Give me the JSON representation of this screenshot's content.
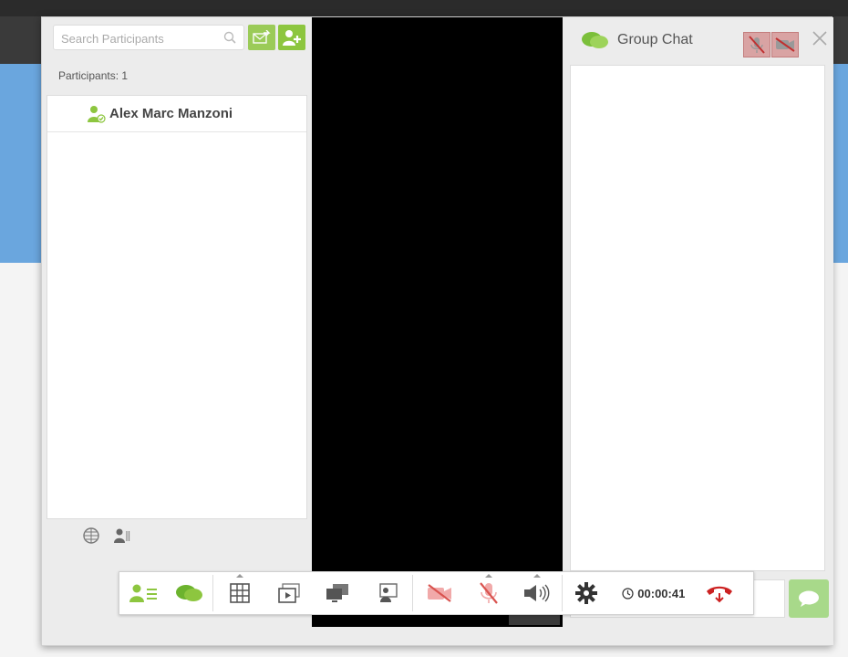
{
  "colors": {
    "accent_green": "#8dc63f",
    "mute_red": "#d9534f",
    "hangup_red": "#cc2222"
  },
  "participants_panel": {
    "search_placeholder": "Search Participants",
    "count_label": "Participants: 1",
    "participants": [
      {
        "name": "Alex Marc Manzoni",
        "icon": "user-check-icon"
      }
    ],
    "footer_icons": [
      "grid-globe-icon",
      "user-list-icon"
    ]
  },
  "chat": {
    "title": "Group Chat",
    "title_icon": "chat-bubbles-icon",
    "input_placeholder": "",
    "send_icon": "speech-bubble-icon"
  },
  "toolbar": {
    "buttons": [
      "participants-icon",
      "chat-icon",
      "grid-layout-icon",
      "slideshow-icon",
      "screen-share-icon",
      "presenter-icon",
      "camera-off-icon",
      "mic-off-icon",
      "speaker-icon",
      "settings-icon",
      "hangup-icon"
    ],
    "timer": "00:00:41"
  }
}
